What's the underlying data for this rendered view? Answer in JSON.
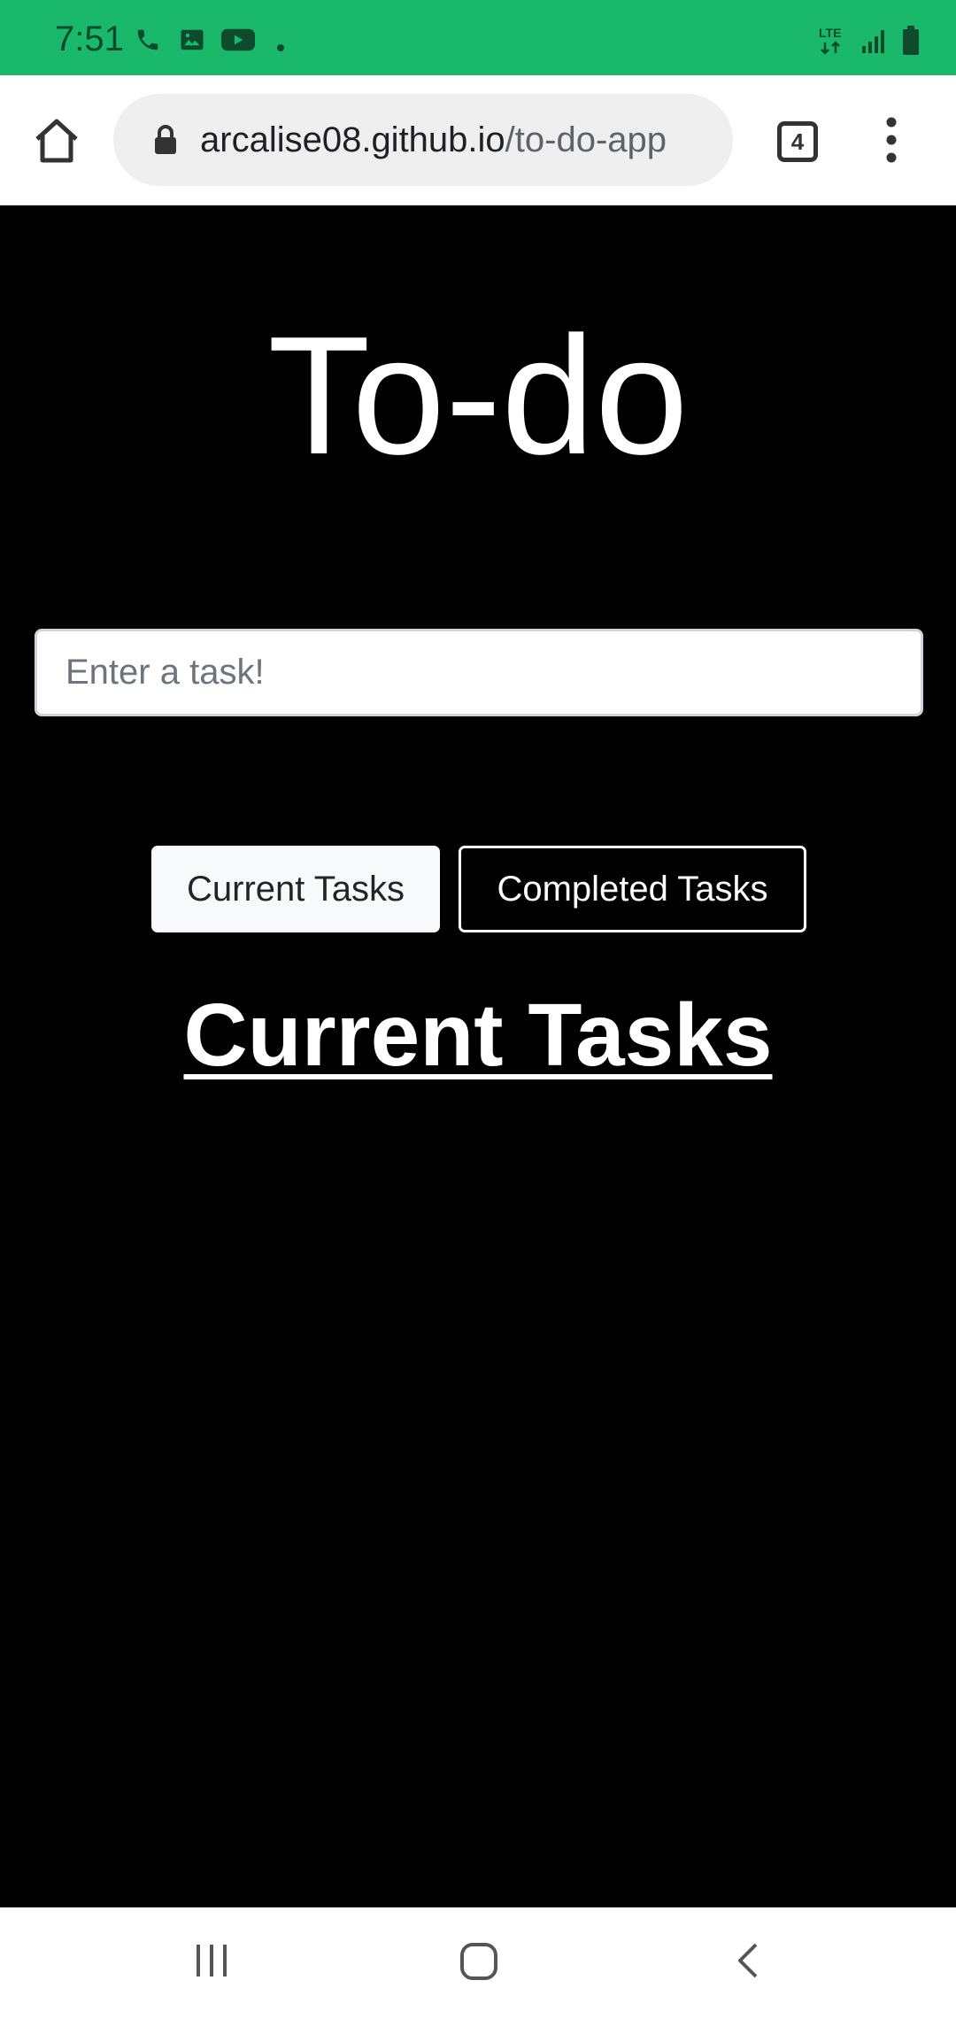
{
  "status_bar": {
    "time": "7:51",
    "background": "#19b86b",
    "left_icons": [
      "phone-icon",
      "gallery-icon",
      "youtube-icon",
      "dot-icon"
    ],
    "right_icons": [
      "lte-icon",
      "signal-icon",
      "battery-icon"
    ],
    "lte_label": "LTE"
  },
  "browser": {
    "url_domain": "arcalise08.github.io",
    "url_path": "/to-do-app",
    "tab_count": "4"
  },
  "page": {
    "title": "To-do",
    "task_input": {
      "placeholder": "Enter a task!",
      "value": ""
    },
    "buttons": {
      "current": "Current Tasks",
      "completed": "Completed Tasks"
    },
    "section_heading": "Current Tasks"
  },
  "nav_bar": {
    "items": [
      "recent-apps-icon",
      "home-icon",
      "back-icon"
    ]
  }
}
